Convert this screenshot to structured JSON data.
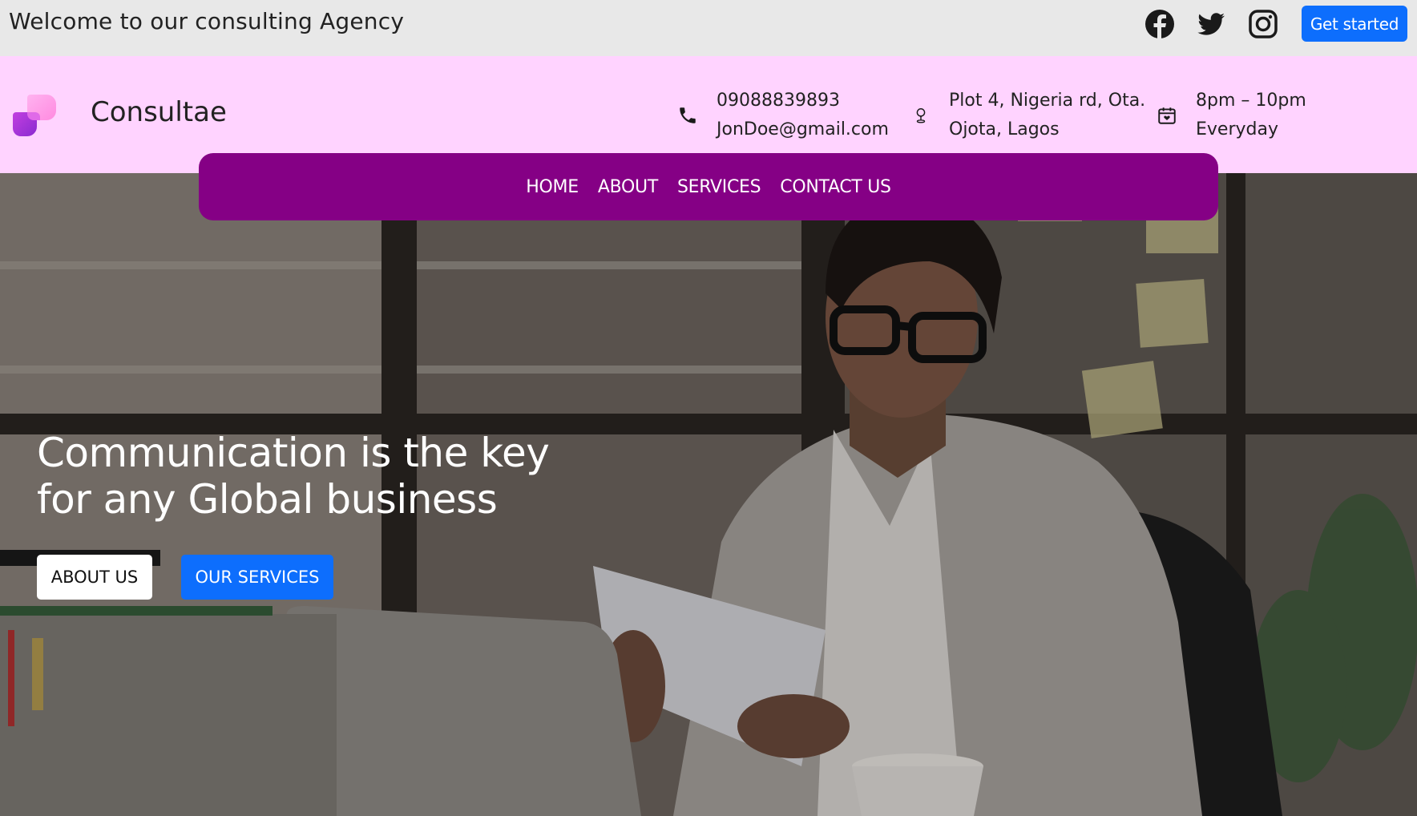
{
  "topbar": {
    "welcome": "Welcome to our consulting Agency",
    "cta_label": "Get started",
    "social": [
      "facebook-icon",
      "twitter-icon",
      "instagram-icon"
    ]
  },
  "header": {
    "brand": "Consultae",
    "phone": "09088839893",
    "email": "JonDoe@gmail.com",
    "address_line1": "Plot 4, Nigeria rd, Ota.",
    "address_line2": "Ojota, Lagos",
    "hours_line1": "8pm – 10pm",
    "hours_line2": "Everyday"
  },
  "nav": {
    "items": [
      "HOME",
      "ABOUT",
      "SERVICES",
      "CONTACT US"
    ]
  },
  "hero": {
    "title_line1": "Communication is the key",
    "title_line2": "for any Global business",
    "about_label": "ABOUT US",
    "services_label": "OUR SERVICES"
  },
  "colors": {
    "topbar_bg": "#e8e8e8",
    "header_bg": "#ffd3ff",
    "nav_bg": "#850085",
    "primary_blue": "#0d6efd"
  }
}
